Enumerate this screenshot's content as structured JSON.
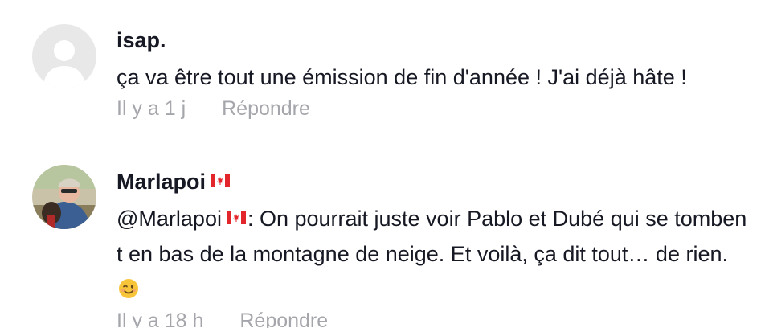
{
  "comments": [
    {
      "username": "isap.",
      "has_flag": false,
      "text": "ça va être tout une émission de fin d'année ! J'ai déjà hâte !",
      "time": "Il y a 1 j",
      "reply_label": "Répondre",
      "avatar": "default-avatar"
    },
    {
      "username": "Marlapoi",
      "has_flag": true,
      "flag_icon": "canada-flag-icon",
      "mention": "@Marlapoi",
      "text_after_mention": ": On pourrait juste voir Pablo et Dubé qui se tombent en bas de la montagne de neige. Et voilà, ça dit tout… de rien.",
      "emoji": "winking-face-icon",
      "time": "Il y a 18 h",
      "reply_label": "Répondre",
      "avatar": "profile-photo-avatar"
    }
  ],
  "colors": {
    "primary_text": "#161823",
    "secondary_text": "#a5a6ab",
    "flag_red": "#e3262b",
    "avatar_bg": "#e8e8e8"
  }
}
